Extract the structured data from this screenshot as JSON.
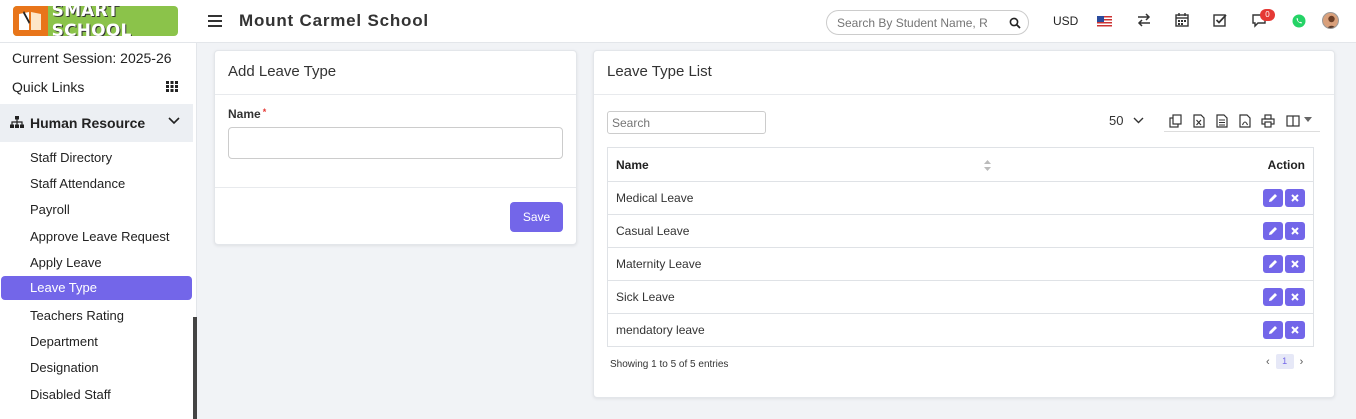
{
  "header": {
    "logo_text": "SMART SCHOOL",
    "school_name": "Mount Carmel School",
    "search_placeholder": "Search By Student Name, R",
    "currency": "USD",
    "notification_count": "0"
  },
  "sidebar": {
    "session": "Current Session: 2025-26",
    "quick_links": "Quick Links",
    "section_title": "Human Resource",
    "items": [
      {
        "label": "Staff Directory"
      },
      {
        "label": "Staff Attendance"
      },
      {
        "label": "Payroll"
      },
      {
        "label": "Approve Leave Request"
      },
      {
        "label": "Apply Leave"
      },
      {
        "label": "Leave Type",
        "active": true
      },
      {
        "label": "Teachers Rating"
      },
      {
        "label": "Department"
      },
      {
        "label": "Designation"
      },
      {
        "label": "Disabled Staff"
      }
    ]
  },
  "add_panel": {
    "title": "Add Leave Type",
    "name_label": "Name",
    "required_mark": "*",
    "name_value": "",
    "save_label": "Save"
  },
  "list_panel": {
    "title": "Leave Type List",
    "search_placeholder": "Search",
    "page_length": "50",
    "columns": {
      "name": "Name",
      "action": "Action"
    },
    "rows": [
      {
        "name": "Medical Leave"
      },
      {
        "name": "Casual Leave"
      },
      {
        "name": "Maternity Leave"
      },
      {
        "name": "Sick Leave"
      },
      {
        "name": "mendatory leave"
      }
    ],
    "showing": "Showing 1 to 5 of 5 entries",
    "pager": {
      "prev": "‹",
      "page": "1",
      "next": "›"
    }
  },
  "colors": {
    "accent": "#7366e9",
    "logo_green": "#8bc34a",
    "logo_orange": "#e8751a"
  }
}
